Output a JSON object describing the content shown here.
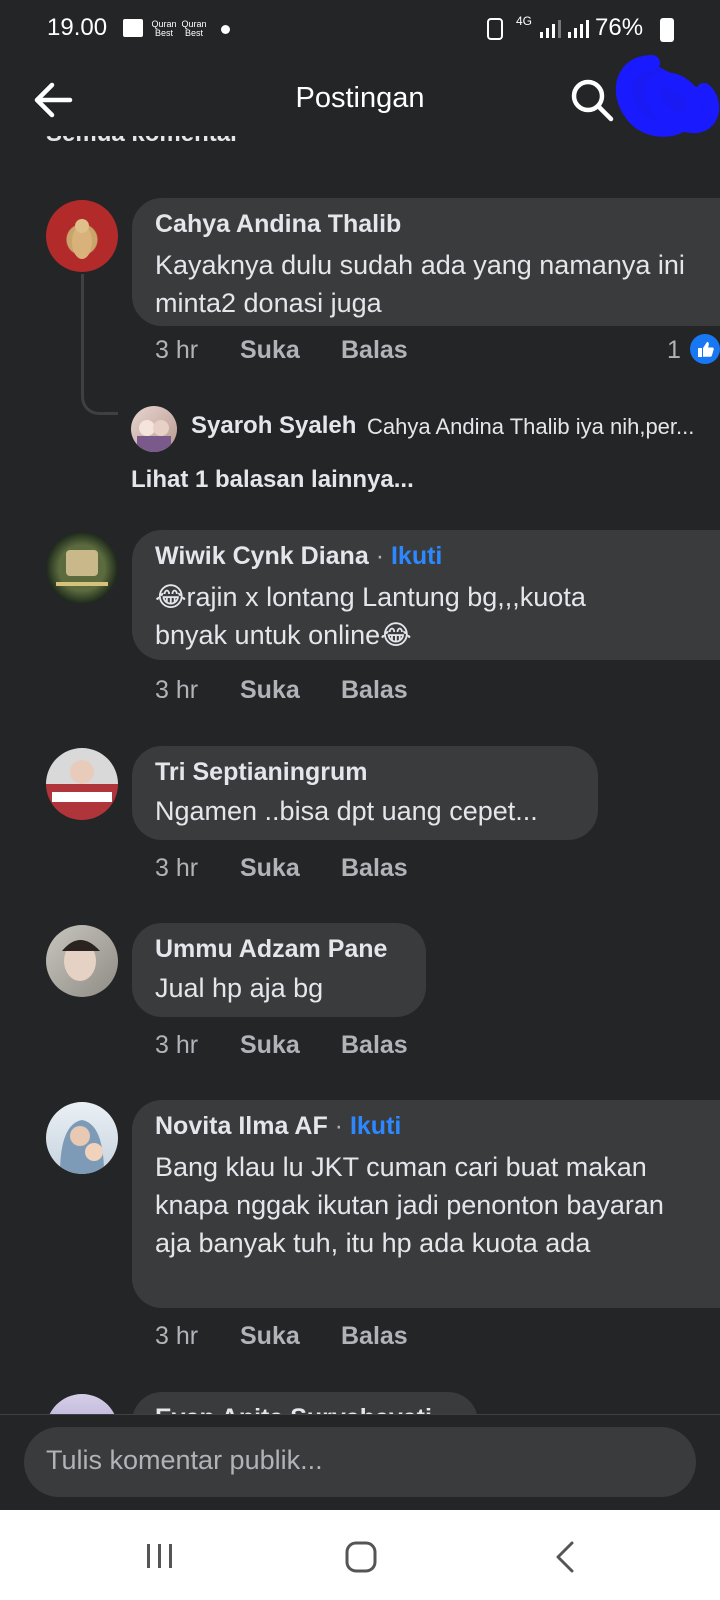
{
  "status_bar": {
    "time": "19.00",
    "notif_label_1": "Quran Best",
    "notif_label_2": "Quran Best",
    "network": "4G",
    "battery": "76%"
  },
  "header": {
    "title": "Postingan",
    "partial_section_label": "Semua komentar"
  },
  "comments": [
    {
      "name": "Cahya Andina Thalib",
      "text": "Kayaknya dulu sudah ada yang namanya ini minta2 donasi juga",
      "time": "3 hr",
      "like": "Suka",
      "reply": "Balas",
      "reaction_count": "1",
      "reply_preview": {
        "name": "Syaroh Syaleh",
        "text": "Cahya Andina Thalib iya nih,per..."
      },
      "more_replies": "Lihat 1 balasan lainnya..."
    },
    {
      "name": "Wiwik Cynk Diana",
      "separator": "·",
      "follow": "Ikuti",
      "text_line1": "😂rajin x lontang Lantung bg,,,kuota",
      "text_line2": "bnyak untuk online😂",
      "time": "3 hr",
      "like": "Suka",
      "reply": "Balas"
    },
    {
      "name": "Tri Septianingrum",
      "text": "Ngamen ..bisa dpt uang cepet...",
      "time": "3 hr",
      "like": "Suka",
      "reply": "Balas"
    },
    {
      "name": "Ummu Adzam Pane",
      "text": "Jual hp aja bg",
      "time": "3 hr",
      "like": "Suka",
      "reply": "Balas"
    },
    {
      "name": "Novita Ilma AF",
      "separator": "·",
      "follow": "Ikuti",
      "text": "Bang klau lu JKT cuman cari buat makan knapa nggak ikutan jadi penonton bayaran aja banyak tuh, itu hp ada kuota ada",
      "time": "3 hr",
      "like": "Suka",
      "reply": "Balas"
    },
    {
      "name": "Evan Anita Suryahayati"
    }
  ],
  "composer": {
    "placeholder": "Tulis komentar publik..."
  },
  "colors": {
    "background": "#242526",
    "bubble": "#3a3b3c",
    "link_blue": "#2d88ff",
    "secondary_text": "#b0b3b8",
    "redaction_blue": "#1a1aff"
  },
  "icons": [
    "back-arrow-icon",
    "search-icon",
    "like-thumb-icon",
    "recents-icon",
    "home-icon",
    "nav-back-icon"
  ]
}
